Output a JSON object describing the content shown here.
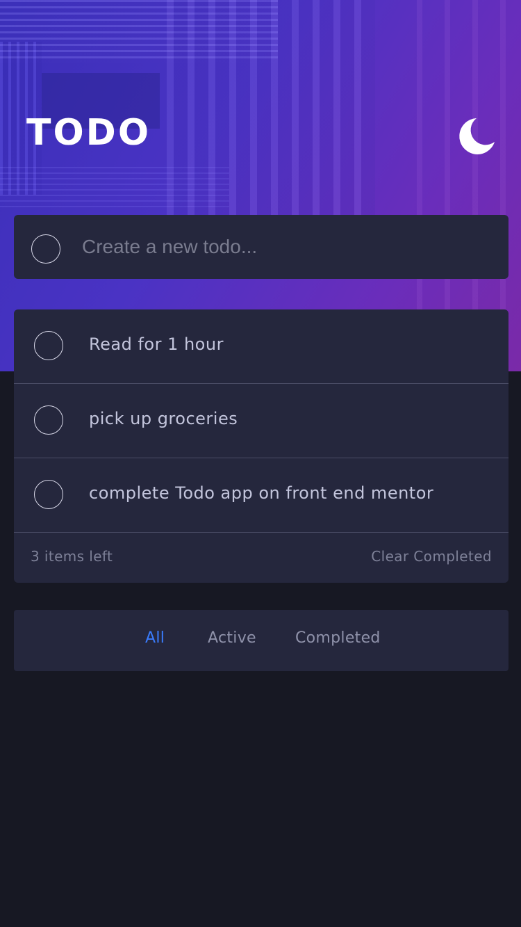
{
  "header": {
    "title": "TODO",
    "theme_icon": "moon-icon"
  },
  "new_todo": {
    "placeholder": "Create a new todo..."
  },
  "todos": [
    {
      "text": "Read for 1 hour",
      "completed": false
    },
    {
      "text": "pick up groceries",
      "completed": false
    },
    {
      "text": "complete Todo app on front end mentor",
      "completed": false
    }
  ],
  "footer": {
    "items_left": "3 items left",
    "clear_label": "Clear Completed"
  },
  "filters": {
    "all": "All",
    "active": "Active",
    "completed": "Completed",
    "selected": "All"
  },
  "colors": {
    "accent": "#3a7cfd",
    "card": "#25273d",
    "background": "#171823"
  }
}
